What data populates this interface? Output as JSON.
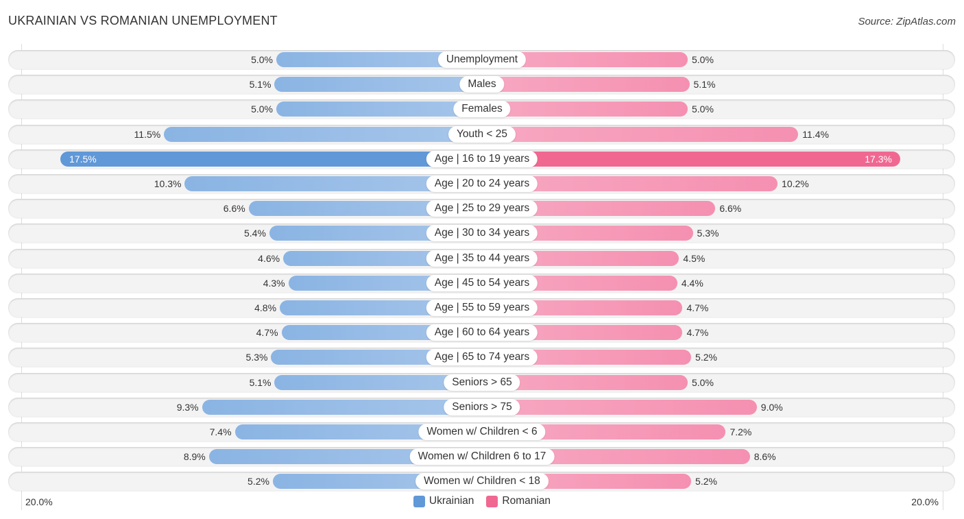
{
  "title": "UKRAINIAN VS ROMANIAN UNEMPLOYMENT",
  "source": "Source: ZipAtlas.com",
  "colors": {
    "ukrainian": "#6098d8",
    "romanian": "#f06892"
  },
  "chart_data": {
    "type": "bar",
    "orientation": "horizontal-diverging",
    "title": "UKRAINIAN VS ROMANIAN UNEMPLOYMENT",
    "categories": [
      "Unemployment",
      "Males",
      "Females",
      "Youth < 25",
      "Age | 16 to 19 years",
      "Age | 20 to 24 years",
      "Age | 25 to 29 years",
      "Age | 30 to 34 years",
      "Age | 35 to 44 years",
      "Age | 45 to 54 years",
      "Age | 55 to 59 years",
      "Age | 60 to 64 years",
      "Age | 65 to 74 years",
      "Seniors > 65",
      "Seniors > 75",
      "Women w/ Children < 6",
      "Women w/ Children 6 to 17",
      "Women w/ Children < 18"
    ],
    "series": [
      {
        "name": "Ukrainian",
        "side": "left",
        "values": [
          5.0,
          5.1,
          5.0,
          11.5,
          17.5,
          10.3,
          6.6,
          5.4,
          4.6,
          4.3,
          4.8,
          4.7,
          5.3,
          5.1,
          9.3,
          7.4,
          8.9,
          5.2
        ],
        "labels": [
          "5.0%",
          "5.1%",
          "5.0%",
          "11.5%",
          "17.5%",
          "10.3%",
          "6.6%",
          "5.4%",
          "4.6%",
          "4.3%",
          "4.8%",
          "4.7%",
          "5.3%",
          "5.1%",
          "9.3%",
          "7.4%",
          "8.9%",
          "5.2%"
        ]
      },
      {
        "name": "Romanian",
        "side": "right",
        "values": [
          5.0,
          5.1,
          5.0,
          11.4,
          17.3,
          10.2,
          6.6,
          5.3,
          4.5,
          4.4,
          4.7,
          4.7,
          5.2,
          5.0,
          9.0,
          7.2,
          8.6,
          5.2
        ],
        "labels": [
          "5.0%",
          "5.1%",
          "5.0%",
          "11.4%",
          "17.3%",
          "10.2%",
          "6.6%",
          "5.3%",
          "4.5%",
          "4.4%",
          "4.7%",
          "4.7%",
          "5.2%",
          "5.0%",
          "9.0%",
          "7.2%",
          "8.6%",
          "5.2%"
        ]
      }
    ],
    "highlight_index": 4,
    "axis": {
      "min_label": "20.0%",
      "max_label": "20.0%",
      "max": 20.0
    },
    "legend": {
      "position": "bottom-center",
      "entries": [
        "Ukrainian",
        "Romanian"
      ]
    },
    "unit": "%"
  }
}
